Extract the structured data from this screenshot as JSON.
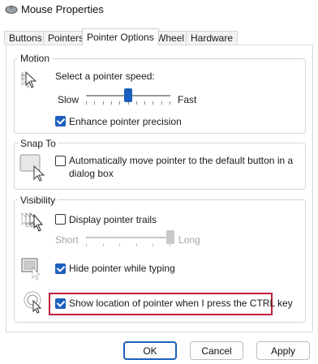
{
  "window": {
    "title": "Mouse Properties",
    "icon": "mouse-icon"
  },
  "tabs": [
    {
      "label": "Buttons",
      "active": false
    },
    {
      "label": "Pointers",
      "active": false
    },
    {
      "label": "Pointer Options",
      "active": true
    },
    {
      "label": "Wheel",
      "active": false
    },
    {
      "label": "Hardware",
      "active": false
    }
  ],
  "motion": {
    "legend": "Motion",
    "icon": "pointer-speed-icon",
    "speed_label": "Select a pointer speed:",
    "slow_label": "Slow",
    "fast_label": "Fast",
    "speed_value": 0.5,
    "precision_label": "Enhance pointer precision",
    "precision_checked": true
  },
  "snap": {
    "legend": "Snap To",
    "icon": "snap-to-button-icon",
    "label_line1": "Automatically move pointer to the default button in a",
    "label_line2": "dialog box",
    "checked": false
  },
  "visibility": {
    "legend": "Visibility",
    "trails_icon": "pointer-trails-icon",
    "trails_label": "Display pointer trails",
    "trails_checked": false,
    "short_label": "Short",
    "long_label": "Long",
    "trails_value": 1.0,
    "hide_icon": "hide-pointer-icon",
    "hide_label": "Hide pointer while typing",
    "hide_checked": true,
    "ctrl_icon": "show-location-icon",
    "ctrl_label": "Show location of pointer when I press the CTRL key",
    "ctrl_checked": true
  },
  "buttons": {
    "ok": "OK",
    "cancel": "Cancel",
    "apply": "Apply"
  },
  "colors": {
    "accent": "#1c5fbe",
    "highlight": "#c0213a"
  }
}
